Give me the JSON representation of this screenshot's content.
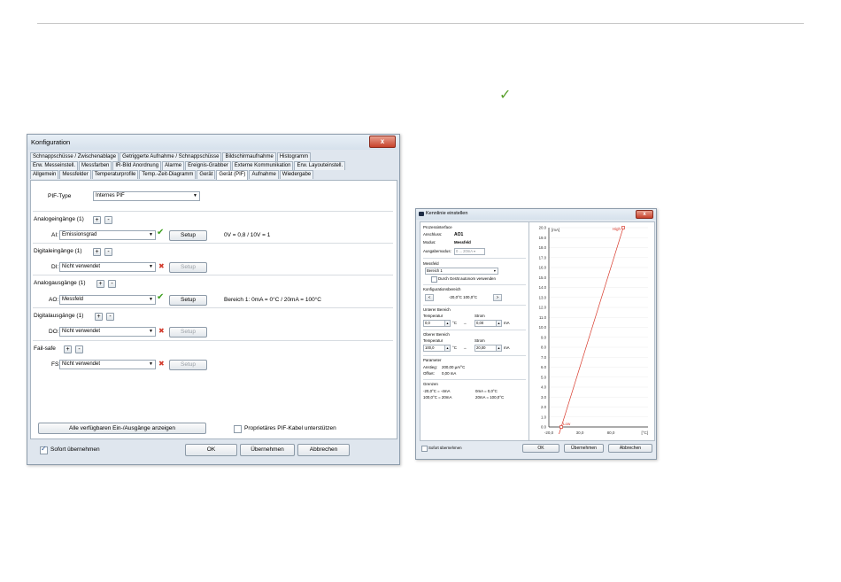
{
  "floating_check": "✓",
  "config": {
    "title": "Konfiguration",
    "close": "x",
    "tab_rows": [
      [
        "Schnappschüsse / Zwischenablage",
        "Getriggerte Aufnahme / Schnappschüsse",
        "Bildschirmaufnahme",
        "Histogramm"
      ],
      [
        "Erw. Messeinstell.",
        "Messfarben",
        "IR-Bild Anordnung",
        "Alarme",
        "Ereignis-Grabber",
        "Externe Kommunikation",
        "Erw. Layouteinstell."
      ],
      [
        "Allgemein",
        "Messfelder",
        "Temperaturprofile",
        "Temp.-Zeit-Diagramm",
        "Gerät",
        "Gerät (PIF)",
        "Aufnahme",
        "Wiedergabe"
      ]
    ],
    "active_tab": "Gerät (PIF)",
    "pif_type_label": "PIF-Type",
    "pif_type_value": "Internes PIF",
    "sections": [
      {
        "header": "Analogeingänge (1)",
        "channel": "AI:",
        "value": "Emissionsgrad",
        "status": "ok",
        "setup": "Setup",
        "setup_enabled": true,
        "info": "0V = 0,8 / 10V = 1"
      },
      {
        "header": "Digitaleingänge (1)",
        "channel": "DI:",
        "value": "Nicht verwendet",
        "status": "x",
        "setup": "Setup",
        "setup_enabled": false,
        "info": ""
      },
      {
        "header": "Analogausgänge (1)",
        "channel": "AO:",
        "value": "Messfeld",
        "status": "ok",
        "setup": "Setup",
        "setup_enabled": true,
        "info": "Bereich 1: 0mA = 0°C / 20mA = 100°C"
      },
      {
        "header": "Digitalausgänge (1)",
        "channel": "DO:",
        "value": "Nicht verwendet",
        "status": "x",
        "setup": "Setup",
        "setup_enabled": false,
        "info": ""
      },
      {
        "header": "Fail-safe",
        "channel": "FS:",
        "value": "Nicht verwendet",
        "status": "x",
        "setup": "Setup",
        "setup_enabled": false,
        "info": ""
      }
    ],
    "plus": "+",
    "minus": "-",
    "show_all_button": "Alle verfügbaren Ein-/Ausgänge anzeigen",
    "proprietary_label": "Proprietäres PIF-Kabel unterstützen",
    "sofort_label": "Sofort übernehmen",
    "ok_button": "OK",
    "apply_button": "Übernehmen",
    "cancel_button": "Abbrechen"
  },
  "kennlinie": {
    "title": "Kennlinie einstellen",
    "close": "x",
    "prozess_header": "Prozessinterface",
    "anschluss_label": "Anschluss:",
    "anschluss_value": "AO1",
    "modus_label": "Modus:",
    "modus_value": "Messfeld",
    "ausgabemodus_label": "Ausgabemodus:",
    "ausgabemodus_value": "0 ... 20mA",
    "messfeld_header": "Messfeld",
    "messfeld_value": "Bereich 1",
    "autonom_label": "Durch Gerät autonom verwenden",
    "konfig_header": "Konfigurationsbereich",
    "konfig_value": "-20,0°C  100,0°C",
    "prev": "<",
    "next": ">",
    "unterer_header": "Unterer Bereich",
    "oberer_header": "Oberer Bereich",
    "temperatur_label": "Temperatur",
    "strom_label": "Strom",
    "unterer_temp": "0,0",
    "unterer_strom": "0,00",
    "oberer_temp": "100,0",
    "oberer_strom": "20,00",
    "unit_c": "°C",
    "unit_ma": "mA",
    "arrow": "→",
    "parameter_header": "Parameter",
    "anstieg_label": "Anstieg:",
    "anstieg_value": "200,00 µA/°C",
    "offset_label": "Offset:",
    "offset_value": "0,00 mA",
    "grenzen_header": "Grenzen",
    "grenze_1a": "-20,0°C = -4mA",
    "grenze_1b": "0mA = 0,0°C",
    "grenze_2a": "100,0°C = 20mA",
    "grenze_2b": "20mA = 100,0°C",
    "sofort_label": "Sofort übernehmen",
    "ok_button": "OK",
    "apply_button": "Übernehmen",
    "cancel_button": "Abbrechen"
  },
  "chart_data": {
    "type": "line",
    "xlabel": "[°C]",
    "ylabel": "[mA]",
    "xlim": [
      -20,
      140
    ],
    "ylim": [
      0,
      20
    ],
    "x_tick_labels": [
      "-20,0",
      "30,0",
      "80,0"
    ],
    "x_ticks": [
      -20,
      30,
      80
    ],
    "y_ticks": [
      0,
      1,
      2,
      3,
      4,
      5,
      6,
      7,
      8,
      9,
      10,
      11,
      12,
      13,
      14,
      15,
      16,
      17,
      18,
      19,
      20
    ],
    "y_tick_labels": [
      "0.0",
      "1.0",
      "2.0",
      "3.0",
      "4.0",
      "5.0",
      "6.0",
      "7.0",
      "8.0",
      "9.0",
      "10.0",
      "11.0",
      "12.0",
      "13.0",
      "14.0",
      "15.0",
      "16.0",
      "17.0",
      "18.0",
      "19.0",
      "20.0"
    ],
    "series": [
      {
        "x": [
          -20,
          0,
          100,
          140
        ],
        "y": [
          -4,
          0,
          20,
          28
        ],
        "color": "#d83a2c"
      }
    ],
    "points": [
      {
        "label": "Low",
        "x": 0,
        "y": 0
      },
      {
        "label": "High",
        "x": 100,
        "y": 20
      }
    ],
    "grid": true
  }
}
